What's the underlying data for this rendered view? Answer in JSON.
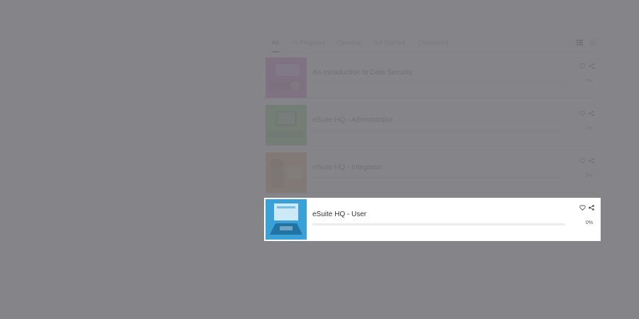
{
  "tabs": [
    {
      "label": "All",
      "active": true
    },
    {
      "label": "In Progress",
      "active": false
    },
    {
      "label": "Overdue",
      "active": false
    },
    {
      "label": "Not Started",
      "active": false
    },
    {
      "label": "Completed",
      "active": false
    }
  ],
  "view_toggle": {
    "selected": "list"
  },
  "courses": [
    {
      "title": "An Introduction to Data Security",
      "progress_label": "0%",
      "progress": 0,
      "thumb_color": "#c23fbf"
    },
    {
      "title": "eSuite HQ - Administrator",
      "progress_label": "0%",
      "progress": 0,
      "thumb_color": "#4fb84a"
    },
    {
      "title": "eSuite HQ - Integrator",
      "progress_label": "0%",
      "progress": 0,
      "thumb_color": "#d0883c"
    },
    {
      "title": "eSuite HQ - User",
      "progress_label": "0%",
      "progress": 0,
      "thumb_color": "#3aa0d8"
    }
  ],
  "highlighted_course": 3,
  "colors": {
    "overlay": "#78787c",
    "accent": "#3aa0d8"
  }
}
